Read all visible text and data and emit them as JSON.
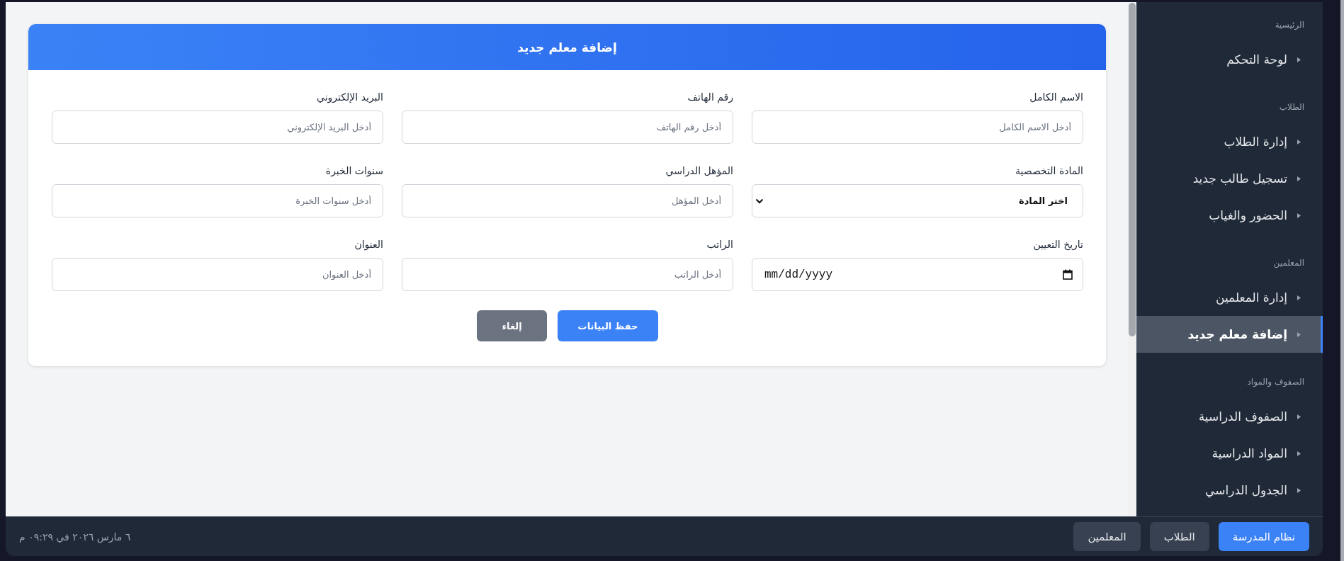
{
  "form": {
    "title": "إضافة معلم جديد",
    "fields": [
      {
        "label": "الاسم الكامل",
        "kind": "text",
        "placeholder": "أدخل الاسم الكامل"
      },
      {
        "label": "رقم الهاتف",
        "kind": "text",
        "placeholder": "أدخل رقم الهاتف"
      },
      {
        "label": "البريد الإلكتروني",
        "kind": "text",
        "placeholder": "أدخل البريد الإلكتروني"
      },
      {
        "label": "المادة التخصصية",
        "kind": "select",
        "value": "اختر المادة"
      },
      {
        "label": "المؤهل الدراسي",
        "kind": "text",
        "placeholder": "أدخل المؤهل"
      },
      {
        "label": "سنوات الخبرة",
        "kind": "text",
        "placeholder": "أدخل سنوات الخبرة"
      },
      {
        "label": "تاريخ التعيين",
        "kind": "date",
        "placeholder": "mm/dd/yyyy"
      },
      {
        "label": "الراتب",
        "kind": "text",
        "placeholder": "أدخل الراتب"
      },
      {
        "label": "العنوان",
        "kind": "text",
        "placeholder": "أدخل العنوان"
      }
    ],
    "buttons": [
      {
        "label": "حفظ البيانات",
        "kind": "primary"
      },
      {
        "label": "إلغاء",
        "kind": "secondary"
      }
    ]
  },
  "sidebar": {
    "sections": [
      {
        "title": "الرئيسية",
        "items": [
          {
            "label": "لوحة التحكم",
            "selected": false
          }
        ]
      },
      {
        "title": "الطلاب",
        "items": [
          {
            "label": "إدارة الطلاب",
            "selected": false
          },
          {
            "label": "تسجيل طالب جديد",
            "selected": false
          },
          {
            "label": "الحضور والغياب",
            "selected": false
          }
        ]
      },
      {
        "title": "المعلمين",
        "items": [
          {
            "label": "إدارة المعلمين",
            "selected": false
          },
          {
            "label": "إضافة معلم جديد",
            "selected": true
          }
        ]
      },
      {
        "title": "الصفوف والمواد",
        "items": [
          {
            "label": "الصفوف الدراسية",
            "selected": false
          },
          {
            "label": "المواد الدراسية",
            "selected": false
          },
          {
            "label": "الجدول الدراسي",
            "selected": false
          }
        ]
      }
    ]
  },
  "footer": {
    "nav": [
      {
        "label": "نظام المدرسة",
        "selected": true
      },
      {
        "label": "الطلاب",
        "selected": false
      },
      {
        "label": "المعلمين",
        "selected": false
      }
    ],
    "timestamp": "٦ مارس ٢٠٢٦ في ٠٩:٢٩ م"
  }
}
